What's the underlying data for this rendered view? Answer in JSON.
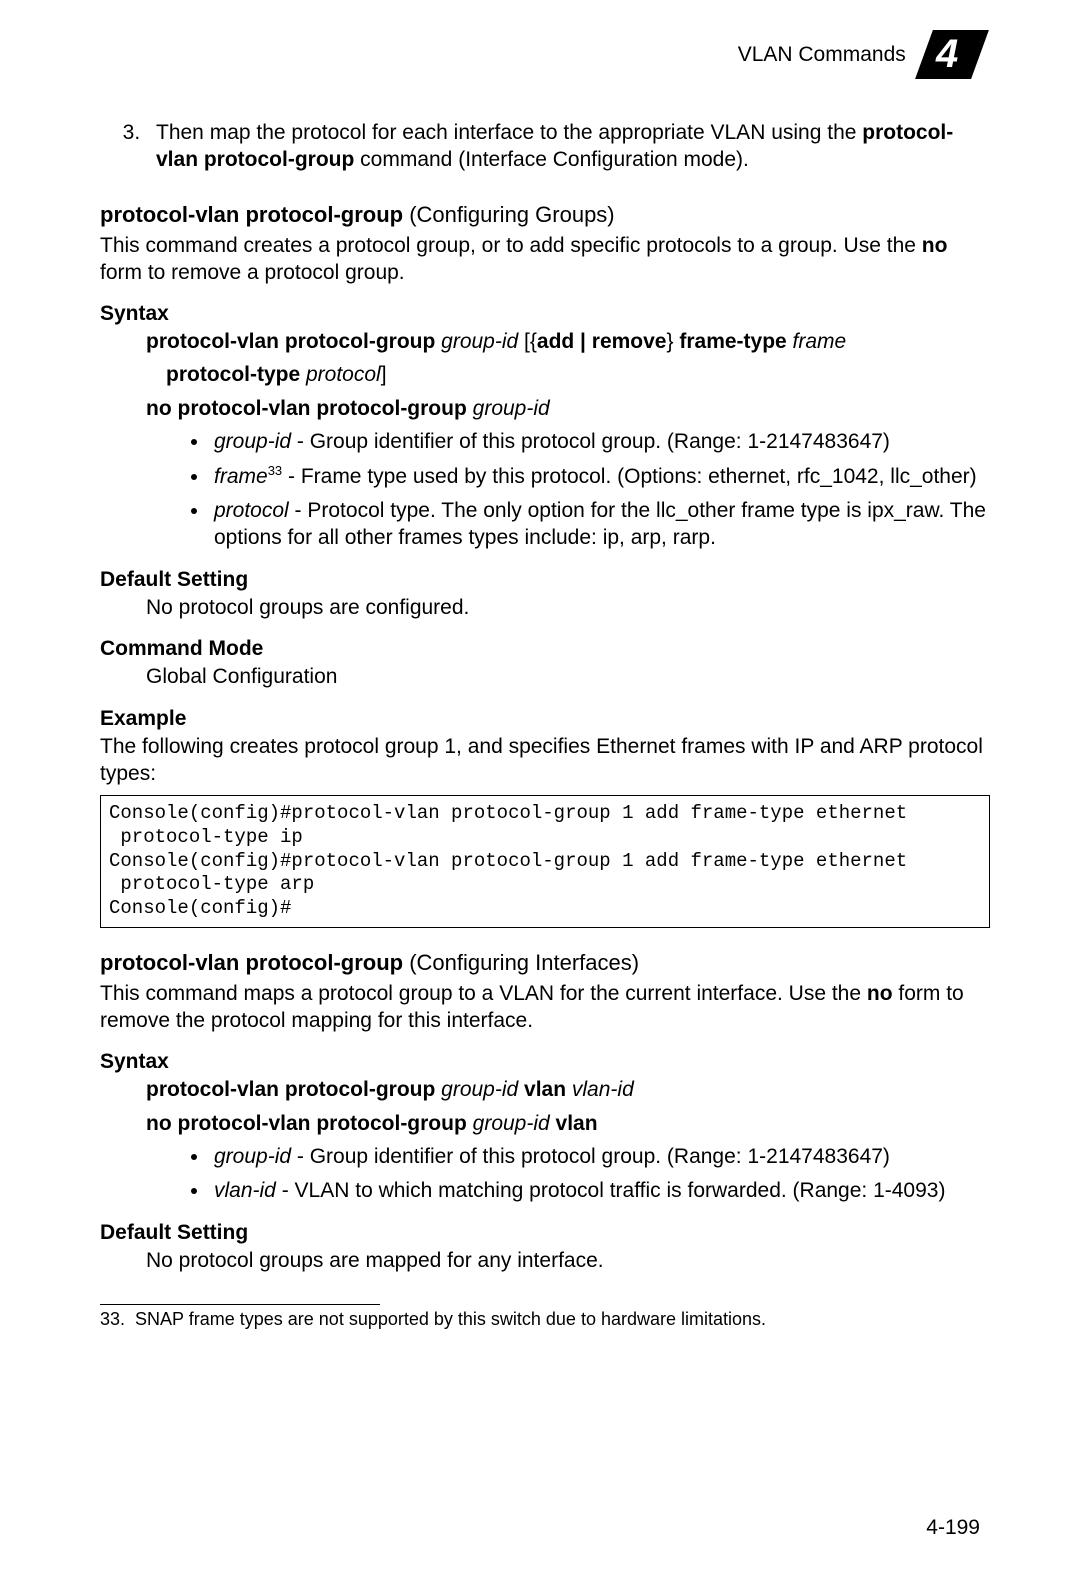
{
  "header": {
    "title": "VLAN Commands",
    "chapter": "4"
  },
  "ol_start": 3,
  "step3": {
    "pre": "Then map the protocol for each interface to the appropriate VLAN using the ",
    "cmd": "protocol-vlan protocol-group",
    "post": " command (Interface Configuration mode)."
  },
  "sec1": {
    "title_cmd": "protocol-vlan protocol-group ",
    "title_rest": "(Configuring Groups)",
    "desc_pre": "This command creates a protocol group, or to add specific protocols to a group. Use the ",
    "desc_bold": "no",
    "desc_post": " form to remove a protocol group.",
    "syntax_label": "Syntax",
    "syntax_l1_b1": "protocol-vlan protocol-group ",
    "syntax_l1_i1": "group-id ",
    "syntax_l1_t1": "[{",
    "syntax_l1_b2": "add | remove",
    "syntax_l1_t2": "} ",
    "syntax_l1_b3": "frame-type ",
    "syntax_l1_i2": "frame",
    "syntax_l2_b1": "protocol-type ",
    "syntax_l2_i1": "protocol",
    "syntax_l2_t1": "]",
    "syntax_l3_b1": "no protocol-vlan protocol-group ",
    "syntax_l3_i1": "group-id",
    "bullets": {
      "b1_i": "group-id",
      "b1_t": " - Group identifier of this protocol group. (Range: 1-2147483647)",
      "b2_i": "frame",
      "b2_sup": "33",
      "b2_t": " - Frame type used by this protocol. (Options: ethernet, rfc_1042, llc_other)",
      "b3_i": "protocol",
      "b3_t": " - Protocol type. The only option for the llc_other frame type is ipx_raw. The options for all other frames types include: ip, arp, rarp."
    },
    "default_label": "Default Setting",
    "default_text": "No protocol groups are configured.",
    "mode_label": "Command Mode",
    "mode_text": "Global Configuration",
    "example_label": "Example",
    "example_intro": "The following creates protocol group 1, and specifies Ethernet frames with IP and ARP protocol types:",
    "console": "Console(config)#protocol-vlan protocol-group 1 add frame-type ethernet\n protocol-type ip\nConsole(config)#protocol-vlan protocol-group 1 add frame-type ethernet\n protocol-type arp\nConsole(config)#"
  },
  "sec2": {
    "title_cmd": "protocol-vlan protocol-group ",
    "title_rest": "(Configuring Interfaces)",
    "desc_pre": "This command maps a protocol group to a VLAN for the current interface. Use the ",
    "desc_bold": "no",
    "desc_post": " form to remove the protocol mapping for this interface.",
    "syntax_label": "Syntax",
    "syntax_l1_b1": "protocol-vlan protocol-group ",
    "syntax_l1_i1": "group-id ",
    "syntax_l1_b2": "vlan ",
    "syntax_l1_i2": "vlan-id",
    "syntax_l2_b1": "no protocol-vlan protocol-group ",
    "syntax_l2_i1": "group-id ",
    "syntax_l2_b2": "vlan",
    "bullets": {
      "b1_i": "group-id",
      "b1_t": " - Group identifier of this protocol group. (Range: 1-2147483647)",
      "b2_i": "vlan-id",
      "b2_t": " - VLAN to which matching protocol traffic is forwarded. (Range: 1-4093)"
    },
    "default_label": "Default Setting",
    "default_text": "No protocol groups are mapped for any interface."
  },
  "footnote": {
    "num": "33.",
    "text": "SNAP frame types are not supported by this switch due to hardware limitations."
  },
  "page_number": "4-199"
}
